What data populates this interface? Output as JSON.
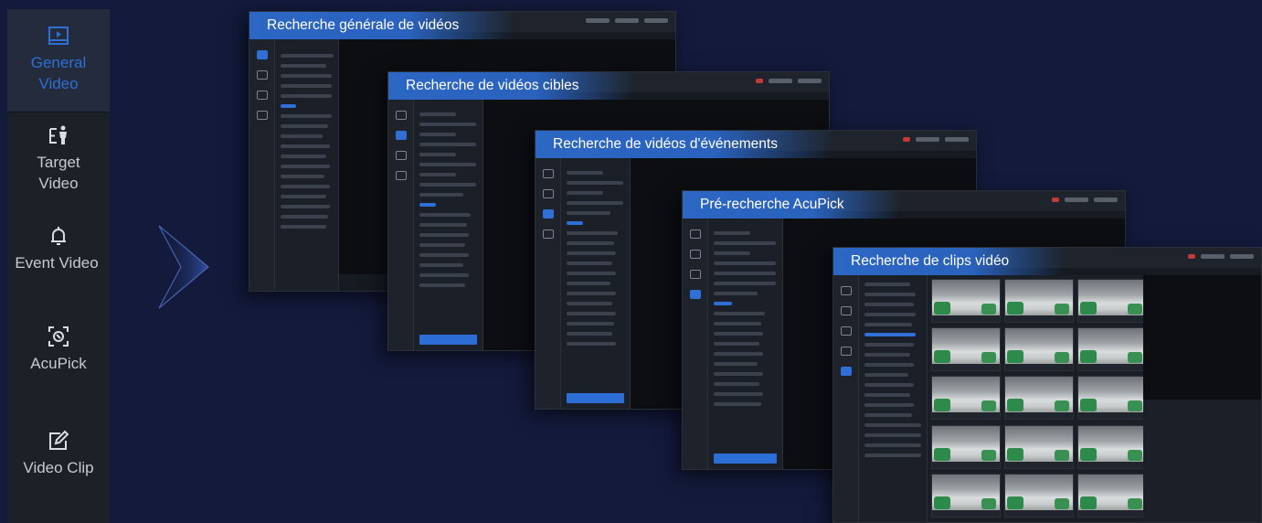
{
  "sidebar": {
    "items": [
      {
        "label_line1": "General",
        "label_line2": "Video",
        "icon": "play-video-icon",
        "active": true
      },
      {
        "label_line1": "Target",
        "label_line2": "Video",
        "icon": "person-target-icon",
        "active": false
      },
      {
        "label_line1": "Event Video",
        "label_line2": "",
        "icon": "bell-icon",
        "active": false
      },
      {
        "label_line1": "AcuPick",
        "label_line2": "",
        "icon": "acupick-scan-icon",
        "active": false
      },
      {
        "label_line1": "Video Clip",
        "label_line2": "",
        "icon": "edit-clip-icon",
        "active": false
      }
    ]
  },
  "arrow_icon": "chevron-right-arrow-icon",
  "windows": [
    {
      "title": "Recherche générale de vidéos"
    },
    {
      "title": "Recherche de vidéos cibles"
    },
    {
      "title": "Recherche de vidéos d'événements"
    },
    {
      "title": "Pré-recherche AcuPick"
    },
    {
      "title": "Recherche de clips vidéo"
    }
  ],
  "colors": {
    "background": "#131a3b",
    "sidebar": "#1c2128",
    "active_accent": "#2f6fd6",
    "title_banner": "#2c67c4"
  }
}
